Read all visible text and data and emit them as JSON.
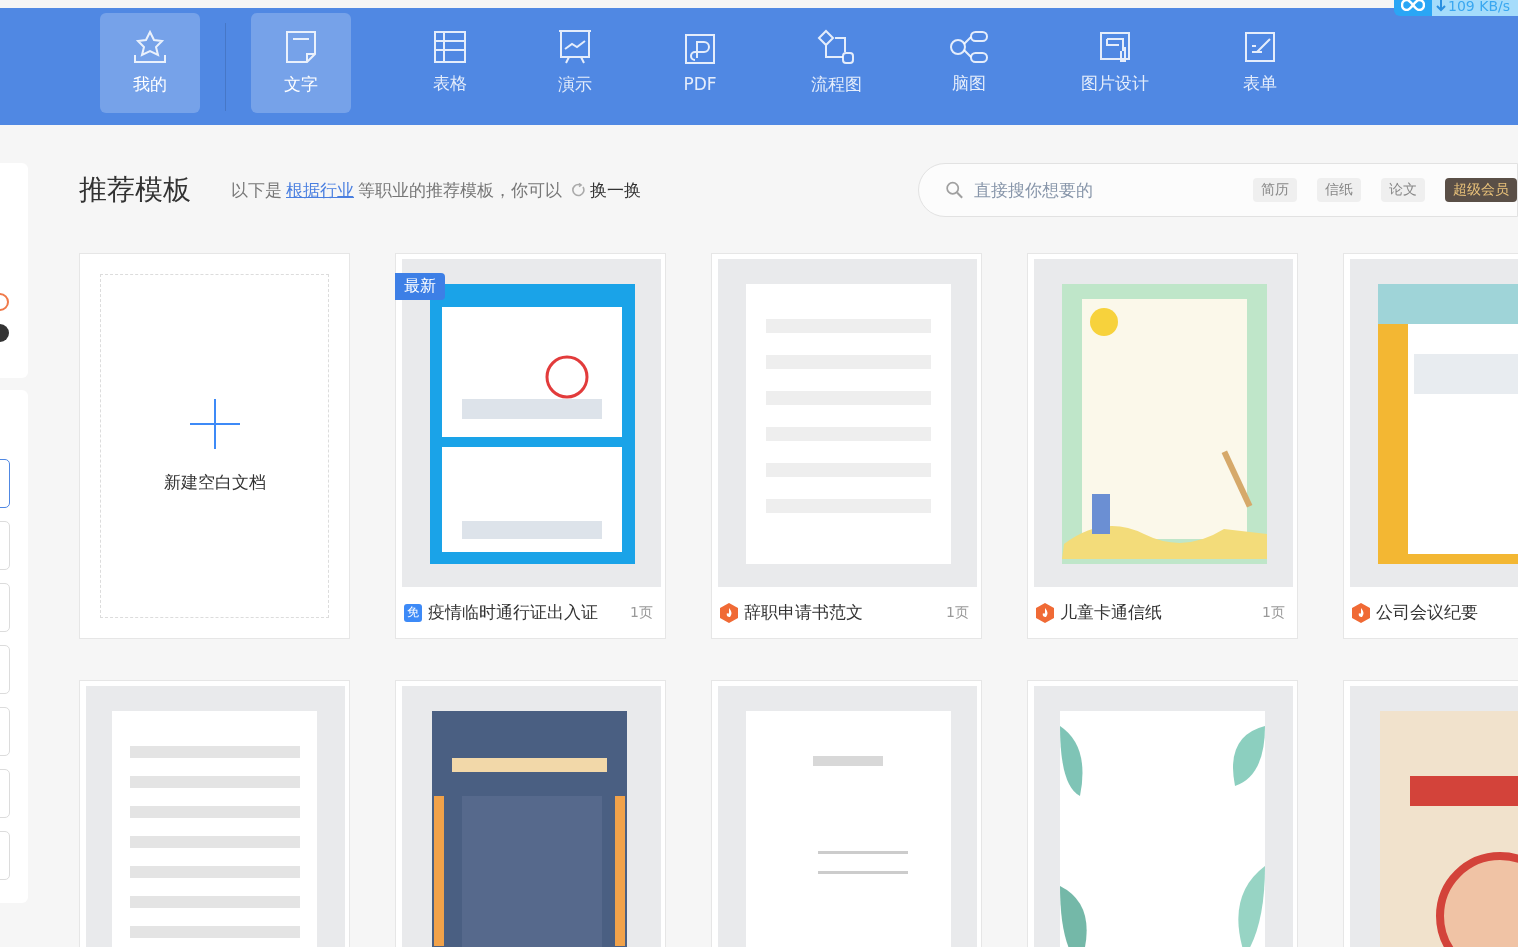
{
  "speed_widget": {
    "reading": "109 KB/s"
  },
  "top_bar": {
    "home": {
      "label": "我的"
    },
    "tabs": [
      {
        "label": "文字",
        "selected": true
      },
      {
        "label": "表格",
        "selected": false
      },
      {
        "label": "演示",
        "selected": false
      },
      {
        "label": "PDF",
        "selected": false
      },
      {
        "label": "流程图",
        "selected": false
      },
      {
        "label": "脑图",
        "selected": false
      },
      {
        "label": "图片设计",
        "selected": false
      },
      {
        "label": "表单",
        "selected": false
      }
    ]
  },
  "sidebar": {
    "dots": [
      {
        "color": "#f07a4a"
      },
      {
        "color": "#333333"
      }
    ],
    "items": [
      {
        "selected": true
      },
      {
        "selected": false
      },
      {
        "selected": false
      },
      {
        "selected": false
      },
      {
        "selected": false
      },
      {
        "selected": false
      },
      {
        "selected": false
      }
    ]
  },
  "header": {
    "title": "推荐模板",
    "intro": "以下是",
    "link": "根据行业",
    "rest": "等职业的推荐模板，你可以",
    "refresh": "换一换"
  },
  "search": {
    "placeholder": "直接搜你想要的",
    "tags": [
      {
        "label": "简历",
        "kind": "plain"
      },
      {
        "label": "信纸",
        "kind": "plain"
      },
      {
        "label": "论文",
        "kind": "plain"
      },
      {
        "label": "超级会员",
        "kind": "vip"
      }
    ]
  },
  "cards": [
    {
      "kind": "new",
      "label": "新建空白文档"
    },
    {
      "kind": "template",
      "badge": "最新",
      "tag": {
        "kind": "free",
        "label": "免"
      },
      "title": "疫情临时通行证出入证",
      "pages": "1页"
    },
    {
      "kind": "template",
      "tag": {
        "kind": "vip"
      },
      "title": "辞职申请书范文",
      "pages": "1页"
    },
    {
      "kind": "template",
      "tag": {
        "kind": "vip"
      },
      "title": "儿童卡通信纸",
      "pages": "1页"
    },
    {
      "kind": "template",
      "tag": {
        "kind": "vip"
      },
      "title": "公司会议纪要"
    },
    {
      "kind": "template"
    },
    {
      "kind": "template"
    },
    {
      "kind": "template"
    },
    {
      "kind": "template"
    },
    {
      "kind": "template"
    }
  ]
}
